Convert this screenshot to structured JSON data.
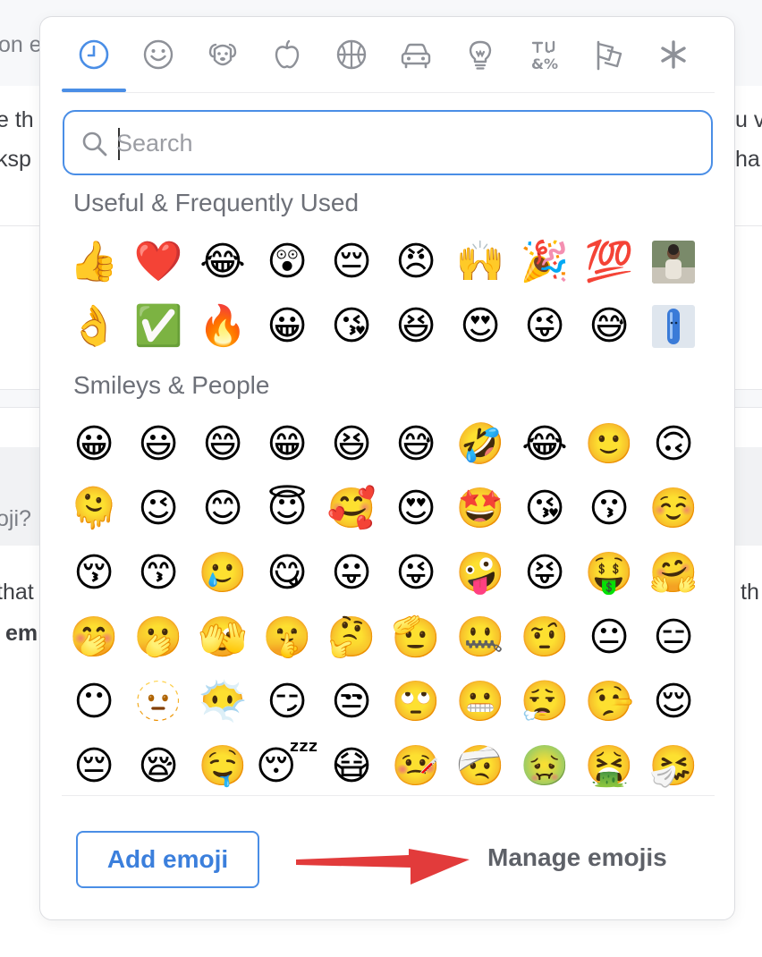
{
  "background": {
    "lines": [
      {
        "text": "on e",
        "right": false
      },
      {
        "text": "e th",
        "right": false
      },
      {
        "text": "ksp",
        "right": false
      },
      {
        "text": "u v",
        "right": true
      },
      {
        "text": "ha",
        "right": true
      },
      {
        "text": "oji?",
        "right": false
      },
      {
        "text": "that",
        "right": false
      },
      {
        "text": "em",
        "right": false
      },
      {
        "text": "th",
        "right": true
      }
    ]
  },
  "tabs": [
    {
      "name": "recent",
      "icon": "clock-icon",
      "active": true
    },
    {
      "name": "smileys",
      "icon": "smiley-icon"
    },
    {
      "name": "animals",
      "icon": "dog-icon"
    },
    {
      "name": "food",
      "icon": "apple-icon"
    },
    {
      "name": "activity",
      "icon": "basketball-icon"
    },
    {
      "name": "travel",
      "icon": "car-icon"
    },
    {
      "name": "objects",
      "icon": "lightbulb-icon"
    },
    {
      "name": "symbols",
      "icon": "symbols-icon"
    },
    {
      "name": "flags",
      "icon": "flags-icon"
    },
    {
      "name": "custom",
      "icon": "asterisk-icon"
    }
  ],
  "search": {
    "placeholder": "Search",
    "value": ""
  },
  "sections": [
    {
      "title": "Useful & Frequently Used",
      "emojis": [
        "👍",
        "❤️",
        "😂",
        "😲",
        "😔",
        "😠",
        "🙌",
        "🎉",
        "💯",
        "[custom-photo]",
        "👌",
        "✅",
        "🔥",
        "😀",
        "😘",
        "😆",
        "😍",
        "😜",
        "😅",
        "[custom-pill]"
      ]
    },
    {
      "title": "Smileys & People",
      "emojis": [
        "😀",
        "😃",
        "😄",
        "😁",
        "😆",
        "😅",
        "🤣",
        "😂",
        "🙂",
        "🙃",
        "🫠",
        "😉",
        "😊",
        "😇",
        "🥰",
        "😍",
        "🤩",
        "😘",
        "😗",
        "☺️",
        "😚",
        "😙",
        "🥲",
        "😋",
        "😛",
        "😜",
        "🤪",
        "😝",
        "🤑",
        "🤗",
        "🤭",
        "🫢",
        "🫣",
        "🤫",
        "🤔",
        "🫡",
        "🤐",
        "🤨",
        "😐",
        "😑",
        "😶",
        "🫥",
        "😶‍🌫️",
        "😏",
        "😒",
        "🙄",
        "😬",
        "😮‍💨",
        "🤥",
        "😌",
        "😔",
        "😪",
        "🤤",
        "😴",
        "😷",
        "🤒",
        "🤕",
        "🤢",
        "🤮",
        "🤧"
      ]
    }
  ],
  "footer": {
    "add_label": "Add emoji",
    "manage_label": "Manage emojis"
  },
  "colors": {
    "accent": "#4a8ee6",
    "arrow": "#e23b3b"
  }
}
